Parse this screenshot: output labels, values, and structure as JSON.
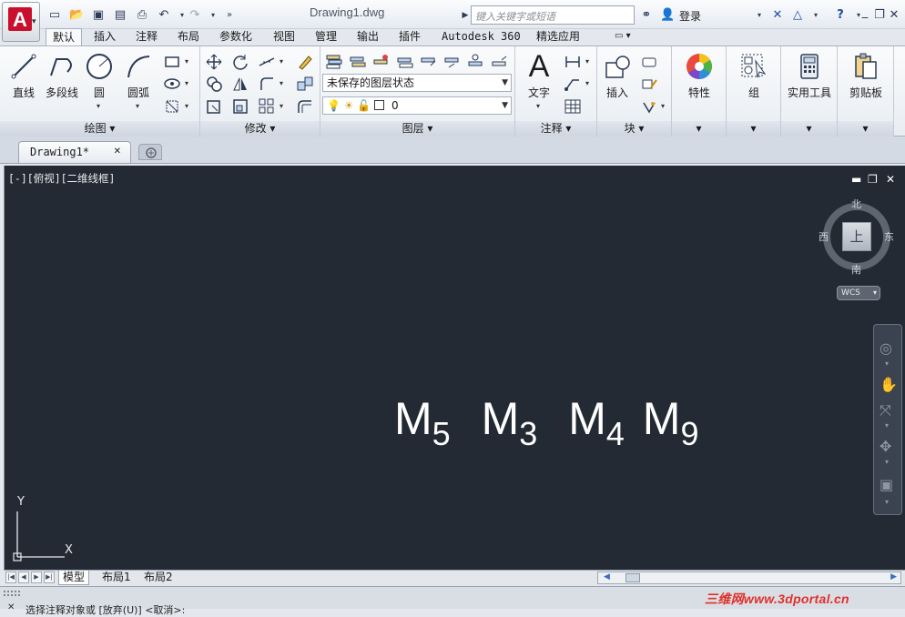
{
  "title_bar": {
    "document_title": "Drawing1.dwg",
    "search_placeholder": "键入关键字或短语",
    "login_label": "登录"
  },
  "ribbon_tabs": [
    "默认",
    "插入",
    "注释",
    "布局",
    "参数化",
    "视图",
    "管理",
    "输出",
    "插件",
    "Autodesk 360",
    "精选应用"
  ],
  "ribbon": {
    "draw": {
      "label": "绘图",
      "line": "直线",
      "polyline": "多段线",
      "circle": "圆",
      "arc": "圆弧"
    },
    "modify": {
      "label": "修改"
    },
    "layers": {
      "label": "图层",
      "layer_state": "未保存的图层状态",
      "current_layer": "0"
    },
    "annotation": {
      "label": "注释",
      "text": "文字"
    },
    "block": {
      "label": "块",
      "insert": "插入"
    },
    "properties": {
      "label": "特性"
    },
    "groups": {
      "label": "组"
    },
    "utilities": {
      "label": "实用工具"
    },
    "clipboard": {
      "label": "剪贴板"
    }
  },
  "document_tab": {
    "label": "Drawing1*"
  },
  "viewport": {
    "label": "[-][俯视][二维线框]",
    "viewcube": {
      "north": "北",
      "south": "南",
      "east": "东",
      "west": "西",
      "face": "上",
      "wcs": "WCS"
    },
    "ucs": {
      "x": "X",
      "y": "Y"
    },
    "mtext": [
      {
        "base": "M",
        "sub": "5"
      },
      {
        "base": "M",
        "sub": "3"
      },
      {
        "base": "M",
        "sub": "4"
      },
      {
        "base": "M",
        "sub": "9"
      }
    ]
  },
  "layout_tabs": [
    "模型",
    "布局1",
    "布局2"
  ],
  "command_line": {
    "text": "选择注释对象或 [放弃(U)] <取消>:"
  },
  "watermark": "三维网www.3dportal.cn",
  "colors": {
    "canvas": "#242a33",
    "accent_red": "#c8102e",
    "ribbon_bg": "#e9edf2"
  }
}
